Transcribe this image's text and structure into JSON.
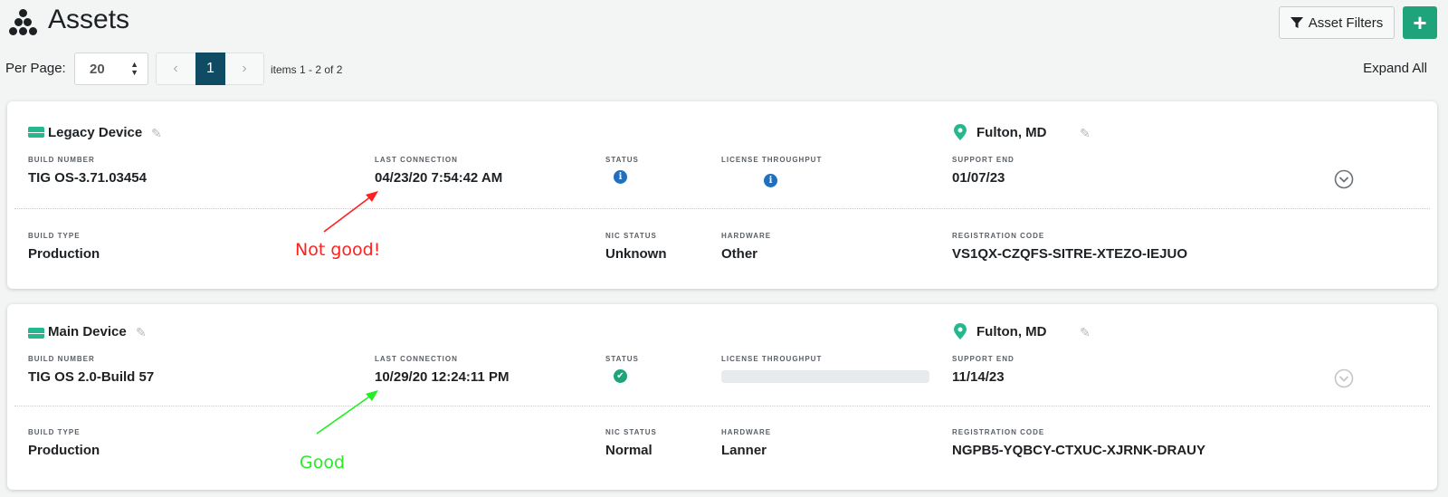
{
  "header": {
    "title": "Assets",
    "logo_icon": "dots-cluster-icon",
    "filters_label": "Asset Filters",
    "filters_icon": "filter-icon",
    "add_label": "+",
    "accent_color": "#1fa37b"
  },
  "toolbar": {
    "per_page_label": "Per Page:",
    "per_page_value": "20",
    "pager": {
      "prev": "‹",
      "current": "1",
      "next": "›"
    },
    "items_info": "items 1 - 2 of 2",
    "expand_all": "Expand All"
  },
  "labels": {
    "build_number": "BUILD NUMBER",
    "last_connection": "LAST CONNECTION",
    "status": "STATUS",
    "license_throughput": "LICENSE THROUGHPUT",
    "support_end": "SUPPORT END",
    "build_type": "BUILD TYPE",
    "nic_status": "NIC STATUS",
    "hardware": "HARDWARE",
    "registration_code": "REGISTRATION CODE"
  },
  "devices": [
    {
      "name": "Legacy Device",
      "location": "Fulton, MD",
      "build_number": "TIG OS-3.71.03454",
      "last_connection": "04/23/20 7:54:42 AM",
      "status_icon": "info-icon",
      "license_throughput_icon": "info-icon",
      "support_end": "01/07/23",
      "build_type": "Production",
      "nic_status": "Unknown",
      "hardware": "Other",
      "registration_code": "VS1QX-CZQFS-SITRE-XTEZO-IEJUO"
    },
    {
      "name": "Main Device",
      "location": "Fulton, MD",
      "build_number": "TIG OS 2.0-Build 57",
      "last_connection": "10/29/20 12:24:11 PM",
      "status_icon": "check-circle-icon",
      "support_end": "11/14/23",
      "build_type": "Production",
      "nic_status": "Normal",
      "hardware": "Lanner",
      "registration_code": "NGPB5-YQBCY-CTXUC-XJRNK-DRAUY"
    }
  ],
  "annotations": [
    {
      "text": "Not good!",
      "color": "#ff2020"
    },
    {
      "text": "Good",
      "color": "#22ee22"
    }
  ]
}
